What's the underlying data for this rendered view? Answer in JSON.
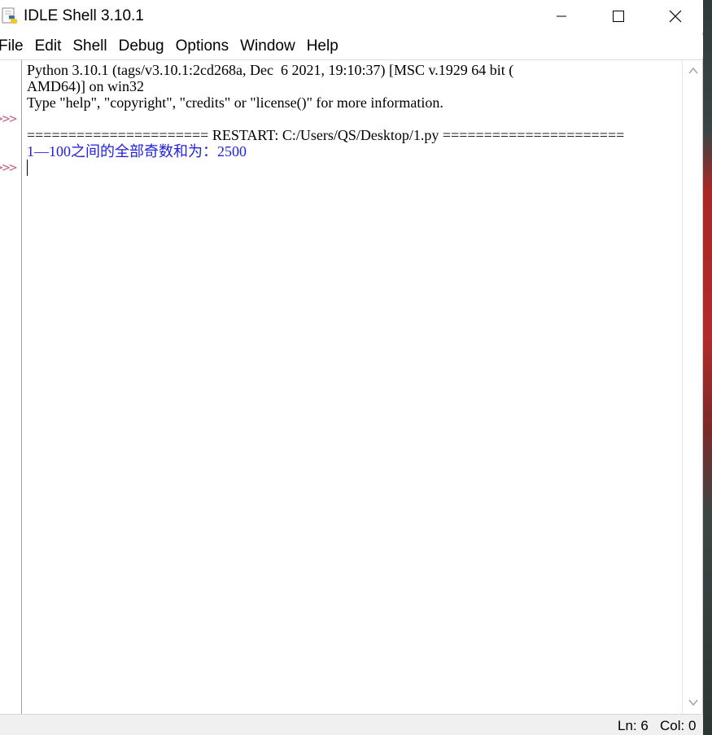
{
  "window": {
    "title": "IDLE Shell 3.10.1",
    "icon": "python-idle-icon"
  },
  "menubar": {
    "items": [
      "File",
      "Edit",
      "Shell",
      "Debug",
      "Options",
      "Window",
      "Help"
    ]
  },
  "shell": {
    "prompt": ">>>",
    "lines": [
      "Python 3.10.1 (tags/v3.10.1:2cd268a, Dec  6 2021, 19:10:37) [MSC v.1929 64 bit (",
      "AMD64)] on win32",
      "Type \"help\", \"copyright\", \"credits\" or \"license()\" for more information.",
      "====================== RESTART: C:/Users/QS/Desktop/1.py ======================",
      "1—100之间的全部奇数和为：2500"
    ]
  },
  "statusbar": {
    "ln": "Ln: 6",
    "col": "Col: 0"
  },
  "colors": {
    "output": "#2222dd",
    "prompt": "#c7638a",
    "text": "#000000"
  }
}
